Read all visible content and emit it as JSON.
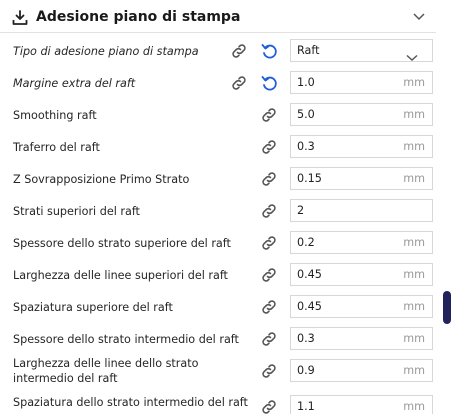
{
  "section": {
    "title": "Adesione piano di stampa"
  },
  "rows": [
    {
      "label": "Tipo di adesione piano di stampa",
      "value": "Raft",
      "unit": "",
      "dropdown": true,
      "italic": true,
      "reset": true
    },
    {
      "label": "Margine extra del raft",
      "value": "1.0",
      "unit": "mm",
      "italic": true,
      "reset": true
    },
    {
      "label": "Smoothing raft",
      "value": "5.0",
      "unit": "mm"
    },
    {
      "label": "Traferro del raft",
      "value": "0.3",
      "unit": "mm"
    },
    {
      "label": "Z Sovrapposizione Primo Strato",
      "value": "0.15",
      "unit": "mm"
    },
    {
      "label": "Strati superiori del raft",
      "value": "2",
      "unit": ""
    },
    {
      "label": "Spessore dello strato superiore del raft",
      "value": "0.2",
      "unit": "mm"
    },
    {
      "label": "Larghezza delle linee superiori del raft",
      "value": "0.45",
      "unit": "mm"
    },
    {
      "label": "Spaziatura superiore del raft",
      "value": "0.45",
      "unit": "mm"
    },
    {
      "label": "Spessore dello strato intermedio del raft",
      "value": "0.3",
      "unit": "mm"
    },
    {
      "label": "Larghezza delle linee dello strato intermedio del raft",
      "value": "0.9",
      "unit": "mm"
    },
    {
      "label": "Spaziatura dello strato intermedio del raft",
      "value": "1.1",
      "unit": "mm"
    }
  ],
  "colors": {
    "accent": "#1f5fd6",
    "icon": "#555555",
    "scroll": "#20245a"
  },
  "icons": {
    "section": "download-tray-icon",
    "link": "link-icon",
    "reset": "reset-arrow-icon",
    "collapse": "chevron-down-icon"
  }
}
